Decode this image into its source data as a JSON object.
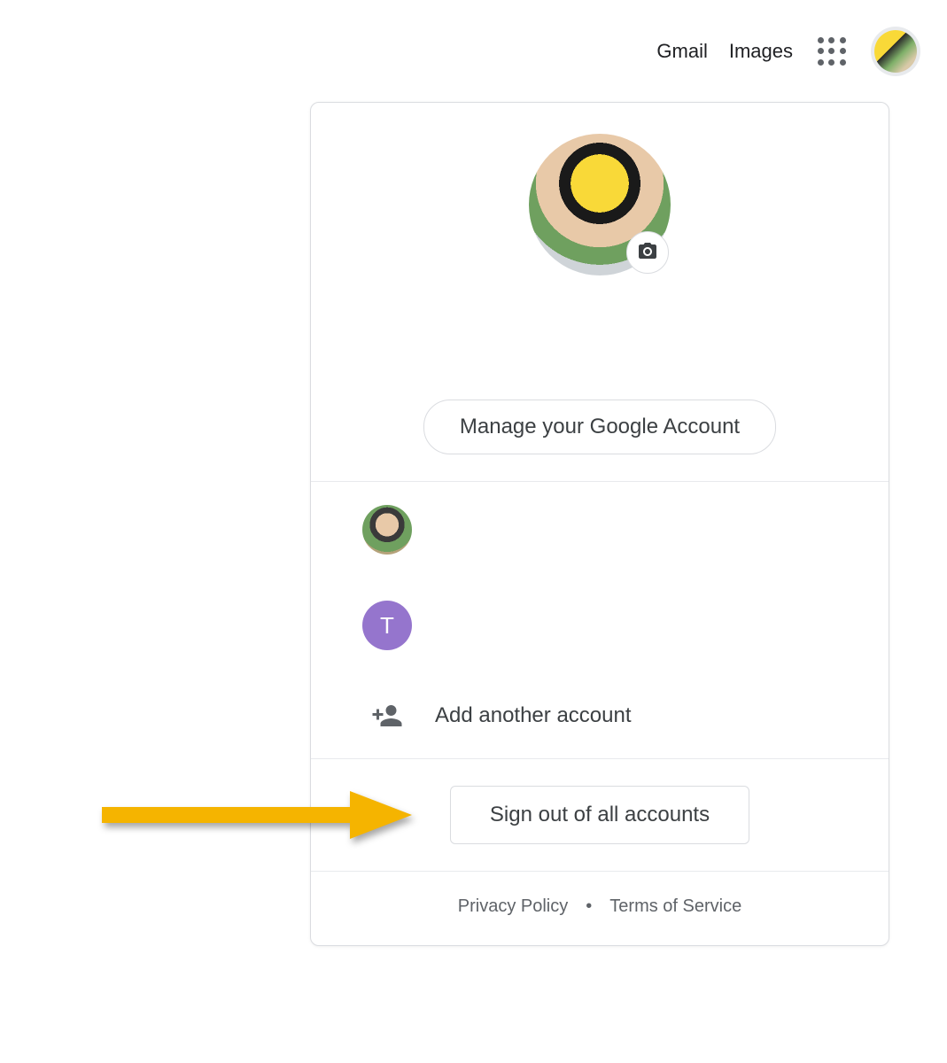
{
  "header": {
    "links": [
      "Gmail",
      "Images"
    ]
  },
  "panel": {
    "manage_label": "Manage your Google Account",
    "accounts": [
      {
        "initial": ""
      },
      {
        "initial": "T"
      }
    ],
    "add_account_label": "Add another account",
    "signout_label": "Sign out of all accounts",
    "footer": {
      "privacy": "Privacy Policy",
      "terms": "Terms of Service"
    }
  },
  "colors": {
    "accent_purple": "#9575cd",
    "annotation_arrow": "#f5b400"
  }
}
